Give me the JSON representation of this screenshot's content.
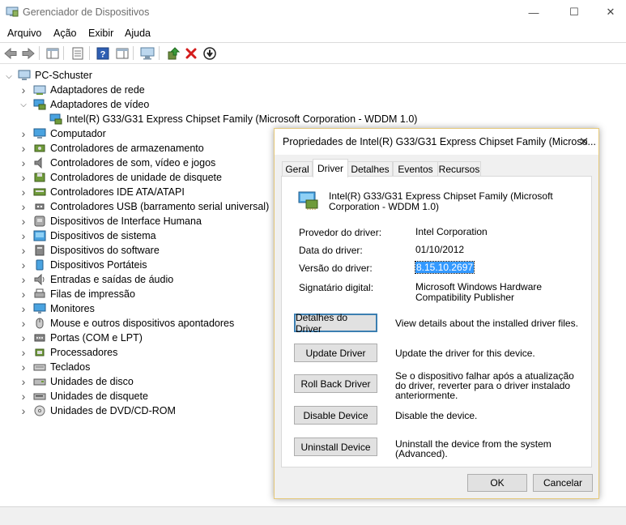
{
  "window": {
    "title": "Gerenciador de Dispositivos",
    "controls": {
      "minimize": "—",
      "maximize": "☐",
      "close": "✕"
    }
  },
  "menu": [
    "Arquivo",
    "Ação",
    "Exibir",
    "Ajuda"
  ],
  "tree": {
    "root": "PC-Schuster",
    "items": [
      {
        "label": "Adaptadores de rede",
        "expanded": false,
        "icon": "network-adapter-icon"
      },
      {
        "label": "Adaptadores de vídeo",
        "expanded": true,
        "icon": "display-adapter-icon",
        "children": [
          "Intel(R) G33/G31 Express Chipset Family (Microsoft Corporation - WDDM 1.0)"
        ]
      },
      {
        "label": "Computador",
        "expanded": false,
        "icon": "computer-icon"
      },
      {
        "label": "Controladores de armazenamento",
        "expanded": false,
        "icon": "storage-controller-icon"
      },
      {
        "label": "Controladores de som, vídeo e jogos",
        "expanded": false,
        "icon": "sound-icon"
      },
      {
        "label": "Controladores de unidade de disquete",
        "expanded": false,
        "icon": "floppy-controller-icon"
      },
      {
        "label": "Controladores IDE ATA/ATAPI",
        "expanded": false,
        "icon": "ide-controller-icon"
      },
      {
        "label": "Controladores USB (barramento serial universal)",
        "expanded": false,
        "icon": "usb-icon"
      },
      {
        "label": "Dispositivos de Interface Humana",
        "expanded": false,
        "icon": "hid-icon"
      },
      {
        "label": "Dispositivos de sistema",
        "expanded": false,
        "icon": "system-device-icon"
      },
      {
        "label": "Dispositivos do software",
        "expanded": false,
        "icon": "software-device-icon"
      },
      {
        "label": "Dispositivos Portáteis",
        "expanded": false,
        "icon": "portable-device-icon"
      },
      {
        "label": "Entradas e saídas de áudio",
        "expanded": false,
        "icon": "audio-io-icon"
      },
      {
        "label": "Filas de impressão",
        "expanded": false,
        "icon": "print-queue-icon"
      },
      {
        "label": "Monitores",
        "expanded": false,
        "icon": "monitor-icon"
      },
      {
        "label": "Mouse e outros dispositivos apontadores",
        "expanded": false,
        "icon": "mouse-icon"
      },
      {
        "label": "Portas (COM e LPT)",
        "expanded": false,
        "icon": "port-icon"
      },
      {
        "label": "Processadores",
        "expanded": false,
        "icon": "processor-icon"
      },
      {
        "label": "Teclados",
        "expanded": false,
        "icon": "keyboard-icon"
      },
      {
        "label": "Unidades de disco",
        "expanded": false,
        "icon": "disk-drive-icon"
      },
      {
        "label": "Unidades de disquete",
        "expanded": false,
        "icon": "floppy-drive-icon"
      },
      {
        "label": "Unidades de DVD/CD-ROM",
        "expanded": false,
        "icon": "dvd-drive-icon"
      }
    ]
  },
  "dialog": {
    "title": "Propriedades de Intel(R) G33/G31 Express Chipset Family (Microso...",
    "tabs": [
      "Geral",
      "Driver",
      "Detalhes",
      "Eventos",
      "Recursos"
    ],
    "active_tab": "Driver",
    "device_name": "Intel(R) G33/G31 Express Chipset Family (Microsoft Corporation - WDDM 1.0)",
    "properties": [
      {
        "label": "Provedor do driver:",
        "value": "Intel Corporation"
      },
      {
        "label": "Data do driver:",
        "value": "01/10/2012"
      },
      {
        "label": "Versão do driver:",
        "value": "8.15.10.2697",
        "selected": true
      },
      {
        "label": "Signatário digital:",
        "value": "Microsoft Windows Hardware Compatibility Publisher"
      }
    ],
    "actions": [
      {
        "label": "Detalhes do Driver",
        "desc": "View details about the installed driver files.",
        "default": true
      },
      {
        "label": "Update Driver",
        "desc": "Update the driver for this device."
      },
      {
        "label": "Roll Back Driver",
        "desc": "Se o dispositivo falhar após a atualização do driver, reverter para o driver instalado anteriormente."
      },
      {
        "label": "Disable Device",
        "desc": "Disable the device."
      },
      {
        "label": "Uninstall Device",
        "desc": "Uninstall the device from the system (Advanced)."
      }
    ],
    "ok_label": "OK",
    "cancel_label": "Cancelar"
  },
  "colors": {
    "selection": "#3399ff",
    "dialog_border": "#e6c97a",
    "default_button_border": "#3c7fb1"
  }
}
